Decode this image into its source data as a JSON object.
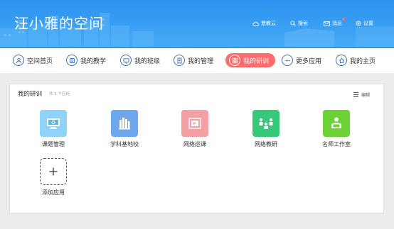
{
  "header": {
    "title": "汪小雅的空间",
    "links": [
      {
        "label": "慧教云",
        "icon": "cloud-icon"
      },
      {
        "label": "搜索",
        "icon": "search-icon"
      },
      {
        "label": "消息",
        "icon": "mail-icon",
        "has_unread_dot": true
      },
      {
        "label": "设置",
        "icon": "gear-icon"
      }
    ]
  },
  "nav": {
    "items": [
      {
        "label": "空间首页",
        "icon": "user-icon"
      },
      {
        "label": "我的教学",
        "icon": "book-icon"
      },
      {
        "label": "我的班级",
        "icon": "monitor-icon"
      },
      {
        "label": "我的管理",
        "icon": "document-icon"
      },
      {
        "label": "我的研训",
        "icon": "grid-icon",
        "active": true
      },
      {
        "label": "更多应用",
        "icon": "more-icon"
      },
      {
        "label": "我的主页",
        "icon": "home-icon"
      }
    ],
    "active_color": "#ff6b6b"
  },
  "panel": {
    "title": "我的研训",
    "subtitle": "共 5 个应用",
    "edit_label": "编辑",
    "apps": [
      {
        "label": "课题管理",
        "icon": "monitor-gear-icon",
        "color": "#8fd3f8"
      },
      {
        "label": "学科基地校",
        "icon": "building-icon",
        "color": "#6ea7ee"
      },
      {
        "label": "网络巡课",
        "icon": "video-icon",
        "color": "#f5a0a4"
      },
      {
        "label": "网络教研",
        "icon": "meeting-icon",
        "color": "#36c97a"
      },
      {
        "label": "名师工作室",
        "icon": "teacher-icon",
        "color": "#6cd134"
      }
    ],
    "add_label": "添加应用"
  },
  "colors": {
    "brand": "#2c93f0",
    "page_bg": "#ececec"
  }
}
